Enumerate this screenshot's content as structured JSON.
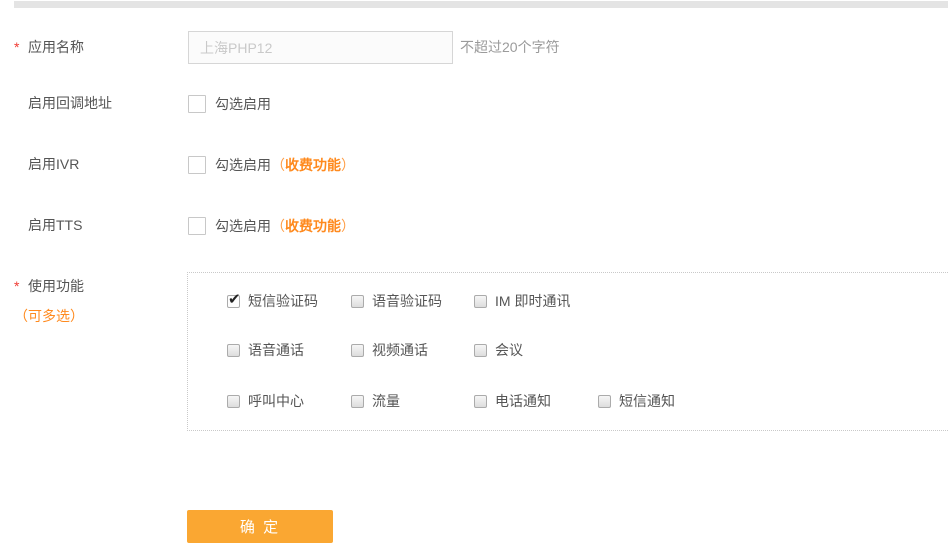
{
  "colors": {
    "accent_orange": "#ff8a1e",
    "button_orange": "#faa732",
    "asterisk_red": "#f03b33",
    "label_gray": "#555555",
    "hint_gray": "#9b9b9b"
  },
  "form": {
    "app_name": {
      "required_mark": "*",
      "label": "应用名称",
      "value": "上海PHP12",
      "hint": "不超过20个字符"
    },
    "callback": {
      "label": "启用回调地址",
      "check_label": "勾选启用"
    },
    "ivr": {
      "label": "启用IVR",
      "check_label": "勾选启用",
      "fee_open": "（",
      "fee_label": "收费功能",
      "fee_close": "）"
    },
    "tts": {
      "label": "启用TTS",
      "check_label": "勾选启用",
      "fee_open": "（",
      "fee_label": "收费功能",
      "fee_close": "）"
    },
    "features": {
      "required_mark": "*",
      "label": "使用功能",
      "sublabel": "（可多选）",
      "rows": [
        [
          {
            "label": "短信验证码",
            "checked": true
          },
          {
            "label": "语音验证码",
            "checked": false
          },
          {
            "label": "IM 即时通讯",
            "checked": false
          }
        ],
        [
          {
            "label": "语音通话",
            "checked": false
          },
          {
            "label": "视频通话",
            "checked": false
          },
          {
            "label": "会议",
            "checked": false
          }
        ],
        [
          {
            "label": "呼叫中心",
            "checked": false
          },
          {
            "label": "流量",
            "checked": false
          },
          {
            "label": "电话通知",
            "checked": false
          },
          {
            "label": "短信通知",
            "checked": false
          }
        ]
      ]
    },
    "submit": {
      "label": "确 定"
    }
  }
}
